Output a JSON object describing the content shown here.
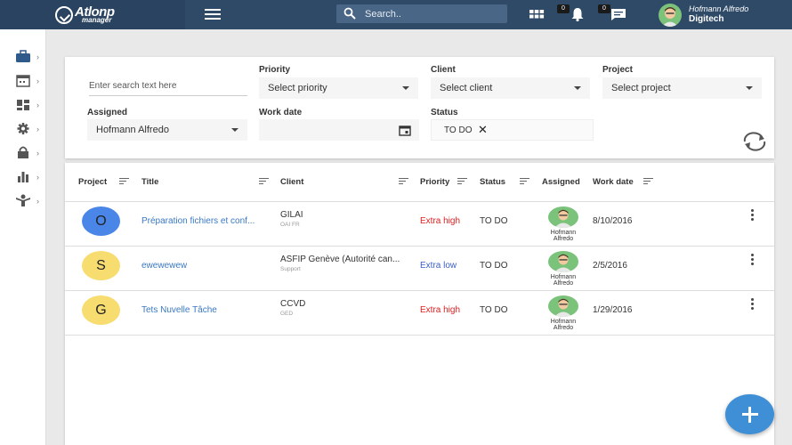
{
  "header": {
    "logo_text": "Atlonp",
    "logo_sub": "manager",
    "search_placeholder": "Search..",
    "notifications_count": "0",
    "messages_count": "0",
    "user_name": "Hofmann Alfredo",
    "user_company": "Digitech"
  },
  "sidebar": {
    "items": [
      {
        "icon": "briefcase-icon"
      },
      {
        "icon": "calendar-icon"
      },
      {
        "icon": "dashboard-icon"
      },
      {
        "icon": "gear-icon"
      },
      {
        "icon": "lock-icon"
      },
      {
        "icon": "bar-chart-icon"
      },
      {
        "icon": "person-icon"
      }
    ]
  },
  "filters": {
    "search_placeholder": "Enter search text here",
    "priority_label": "Priority",
    "priority_value": "Select priority",
    "client_label": "Client",
    "client_value": "Select client",
    "project_label": "Project",
    "project_value": "Select project",
    "assigned_label": "Assigned",
    "assigned_value": "Hofmann Alfredo",
    "workdate_label": "Work date",
    "workdate_value": "",
    "status_label": "Status",
    "status_chip": "TO DO"
  },
  "table": {
    "columns": [
      "Project",
      "Title",
      "Client",
      "Priority",
      "Status",
      "Assigned",
      "Work date"
    ],
    "rows": [
      {
        "project_letter": "O",
        "project_color": "#4a86e8",
        "title": "Préparation fichiers et conf...",
        "client": "GILAI",
        "client_sub": "OAI FR",
        "priority": "Extra high",
        "priority_level": "high",
        "status": "TO DO",
        "assigned": "Hofmann Alfredo",
        "assigned_line1": "Hofmann",
        "assigned_line2": "Alfredo",
        "work_date": "8/10/2016"
      },
      {
        "project_letter": "S",
        "project_color": "#f7dc6f",
        "title": "ewewewew",
        "client": "ASFIP Genève (Autorité can...",
        "client_sub": "Support",
        "priority": "Extra low",
        "priority_level": "low",
        "status": "TO DO",
        "assigned": "Hofmann Alfredo",
        "assigned_line1": "Hofmann",
        "assigned_line2": "Alfredo",
        "work_date": "2/5/2016"
      },
      {
        "project_letter": "G",
        "project_color": "#f7dc6f",
        "title": "Tets Nuvelle Tâche",
        "client": "CCVD",
        "client_sub": "GED",
        "priority": "Extra high",
        "priority_level": "high",
        "status": "TO DO",
        "assigned": "Hofmann Alfredo",
        "assigned_line1": "Hofmann",
        "assigned_line2": "Alfredo",
        "work_date": "1/29/2016"
      }
    ]
  },
  "colors": {
    "topbar": "#2f4a67",
    "accent": "#3f8fd6",
    "priority_high": "#e01e1e",
    "priority_low": "#3a5ec8"
  }
}
